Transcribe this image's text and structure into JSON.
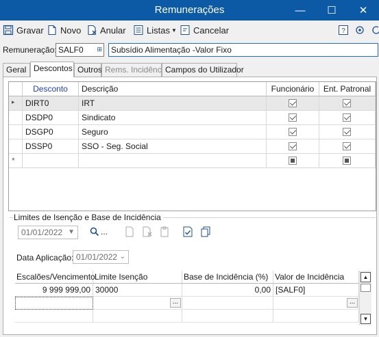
{
  "window": {
    "title": "Remunerações",
    "controls": {
      "minimize": "—",
      "maximize": "☐",
      "close": "✕"
    }
  },
  "toolbar": {
    "save_label": "Gravar",
    "new_label": "Novo",
    "cancel_record_label": "Anular",
    "lists_label": "Listas",
    "cancel_label": "Cancelar"
  },
  "header": {
    "remuneracao_label": "Remuneração:",
    "code_value": "SALF0",
    "description_value": "Subsídio Alimentação -Valor Fixo"
  },
  "tabs": [
    {
      "label": "Geral",
      "state": "normal"
    },
    {
      "label": "Descontos",
      "state": "active"
    },
    {
      "label": "Outros",
      "state": "normal"
    },
    {
      "label": "Rems. Incidência",
      "state": "disabled"
    },
    {
      "label": "Campos do Utilizador",
      "state": "normal"
    }
  ],
  "discounts_grid": {
    "columns": [
      "Desconto",
      "Descrição",
      "Funcionário",
      "Ent. Patronal"
    ],
    "rows": [
      {
        "code": "DIRT0",
        "description": "IRT",
        "funcionario": true,
        "patronal": true
      },
      {
        "code": "DSDP0",
        "description": "Sindicato",
        "funcionario": true,
        "patronal": true
      },
      {
        "code": "DSGP0",
        "description": "Seguro",
        "funcionario": true,
        "patronal": true
      },
      {
        "code": "DSSP0",
        "description": "SSO - Seg. Social",
        "funcionario": true,
        "patronal": true
      }
    ],
    "current_row_marker": "▸",
    "new_row_marker": "*"
  },
  "limits": {
    "group_label": "Limites de Isenção e Base de Incidência",
    "date_combo_value": "01/01/2022",
    "search_more": "...",
    "data_aplicacao_label": "Data Aplicação:",
    "data_aplicacao_value": "01/01/2022",
    "columns": [
      "Escalões/Vencimento",
      "Limite Isenção",
      "Base de Incidência (%)",
      "Valor de Incidência"
    ],
    "rows": [
      {
        "escaloes": "9 999 999,00",
        "limite": "30000",
        "base": "0,00",
        "valor": "[SALF0]"
      }
    ],
    "ellipsis": "..."
  },
  "colors": {
    "titlebar": "#0c5aa6",
    "header_link": "#1e3fc7",
    "selected_row": "#e8e8e8"
  }
}
